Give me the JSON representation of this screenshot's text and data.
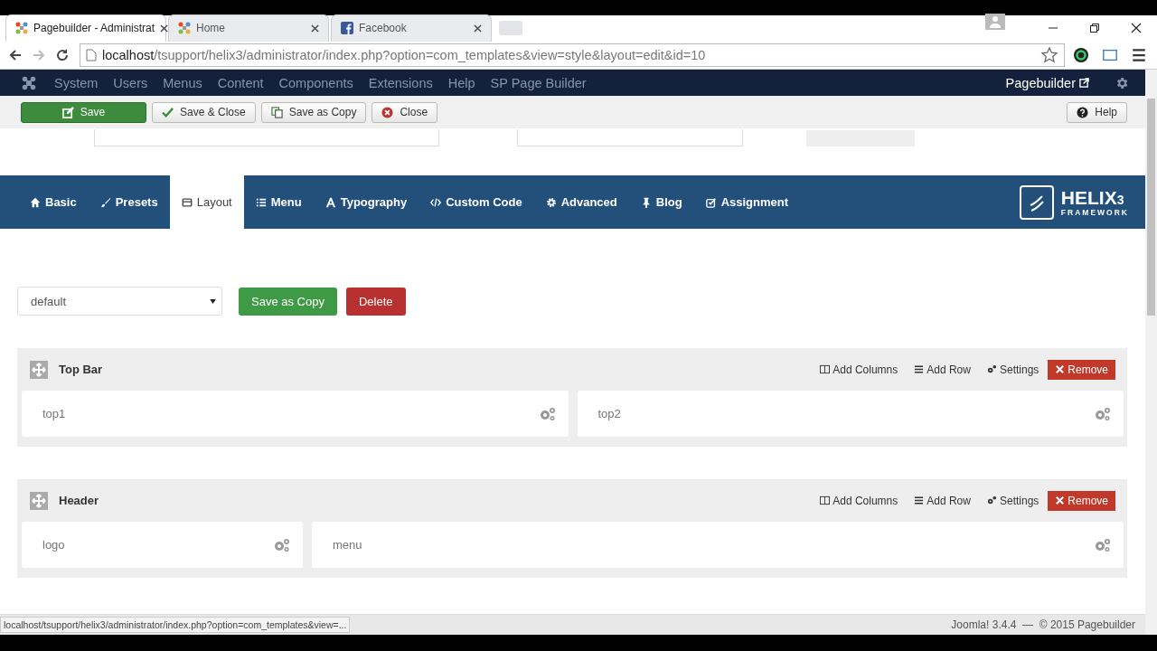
{
  "browser_tabs": [
    {
      "title": "Pagebuilder - Administrat",
      "selected": true
    },
    {
      "title": "Home",
      "selected": false
    },
    {
      "title": "Facebook",
      "selected": false
    }
  ],
  "address": {
    "host": "localhost",
    "path": "/tsupport/helix3/administrator/index.php?option=com_templates&view=style&layout=edit&id=10"
  },
  "admin_menu": [
    "System",
    "Users",
    "Menus",
    "Content",
    "Components",
    "Extensions",
    "Help",
    "SP Page Builder"
  ],
  "site_link": "Pagebuilder",
  "toolbar": [
    {
      "label": "Save",
      "kind": "primary"
    },
    {
      "label": "Save & Close",
      "kind": "check"
    },
    {
      "label": "Save as Copy",
      "kind": "copy"
    },
    {
      "label": "Close",
      "kind": "close"
    }
  ],
  "help_button": "Help",
  "helix_tabs": [
    {
      "label": "Basic",
      "selected": false
    },
    {
      "label": "Presets",
      "selected": false
    },
    {
      "label": "Layout",
      "selected": true
    },
    {
      "label": "Menu",
      "selected": false
    },
    {
      "label": "Typography",
      "selected": false
    },
    {
      "label": "Custom Code",
      "selected": false
    },
    {
      "label": "Advanced",
      "selected": false
    },
    {
      "label": "Blog",
      "selected": false
    },
    {
      "label": "Assignment",
      "selected": false
    }
  ],
  "logo": {
    "name": "HELIX",
    "version": "3",
    "tagline": "FRAMEWORK"
  },
  "layout_select": {
    "value": "default"
  },
  "layout_buttons": [
    "Save as Copy",
    "Delete"
  ],
  "sections": [
    {
      "title": "Top Bar",
      "actions": [
        "Add Columns",
        "Add Row",
        "Settings",
        "Remove"
      ],
      "columns": [
        "top1",
        "top2"
      ]
    },
    {
      "title": "Header",
      "actions": [
        "Add Columns",
        "Add Row",
        "Settings",
        "Remove"
      ],
      "columns": [
        "logo",
        "menu"
      ]
    }
  ],
  "status_url": "localhost/tsupport/helix3/administrator/index.php?option=com_templates&view=...",
  "footer": "Joomla! 3.4.4  —  © 2015 Pagebuilder"
}
